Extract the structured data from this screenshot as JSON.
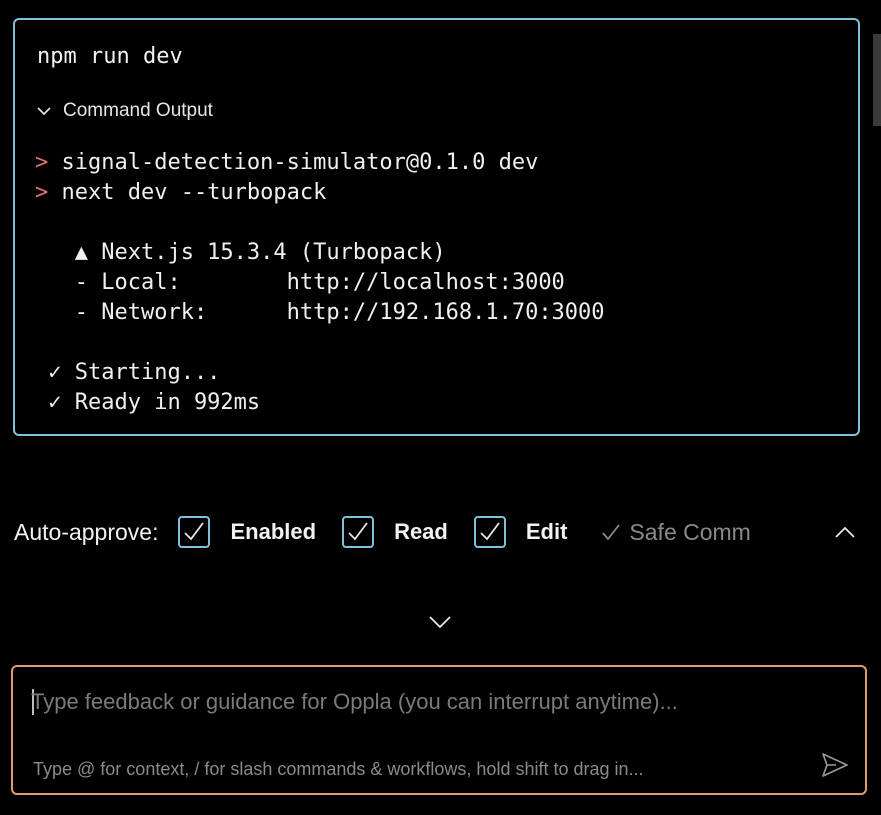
{
  "terminal": {
    "command": "npm run dev",
    "output_toggle_label": "Command Output",
    "lines": [
      {
        "prompt": ">",
        "text": " signal-detection-simulator@0.1.0 dev"
      },
      {
        "prompt": ">",
        "text": " next dev --turbopack"
      },
      {
        "prompt": "",
        "text": ""
      },
      {
        "prompt": "",
        "text": "   ▲ Next.js 15.3.4 (Turbopack)"
      },
      {
        "prompt": "",
        "text": "   - Local:        http://localhost:3000"
      },
      {
        "prompt": "",
        "text": "   - Network:      http://192.168.1.70:3000"
      },
      {
        "prompt": "",
        "text": ""
      },
      {
        "prompt": "",
        "text": " ✓ Starting..."
      },
      {
        "prompt": "",
        "text": " ✓ Ready in 992ms"
      }
    ]
  },
  "auto_approve": {
    "label": "Auto-approve:",
    "options": [
      {
        "label": "Enabled",
        "checked": true
      },
      {
        "label": "Read",
        "checked": true
      },
      {
        "label": "Edit",
        "checked": true
      }
    ],
    "safe_label": "Safe Comm"
  },
  "input": {
    "placeholder": "Type feedback or guidance for Oppla (you can interrupt anytime)...",
    "value": "",
    "hint": "Type @ for context, / for slash commands & workflows, hold shift to drag in..."
  },
  "colors": {
    "terminal_border": "#7fc1d6",
    "prompt": "#e0707a",
    "input_border": "#e59a6c",
    "muted": "#8a8a8a"
  },
  "icons": {
    "output_toggle": "chevron-down-icon",
    "checkbox": "check-icon",
    "expand": "chevron-up-icon",
    "collapse": "chevron-down-icon",
    "send": "send-icon"
  }
}
